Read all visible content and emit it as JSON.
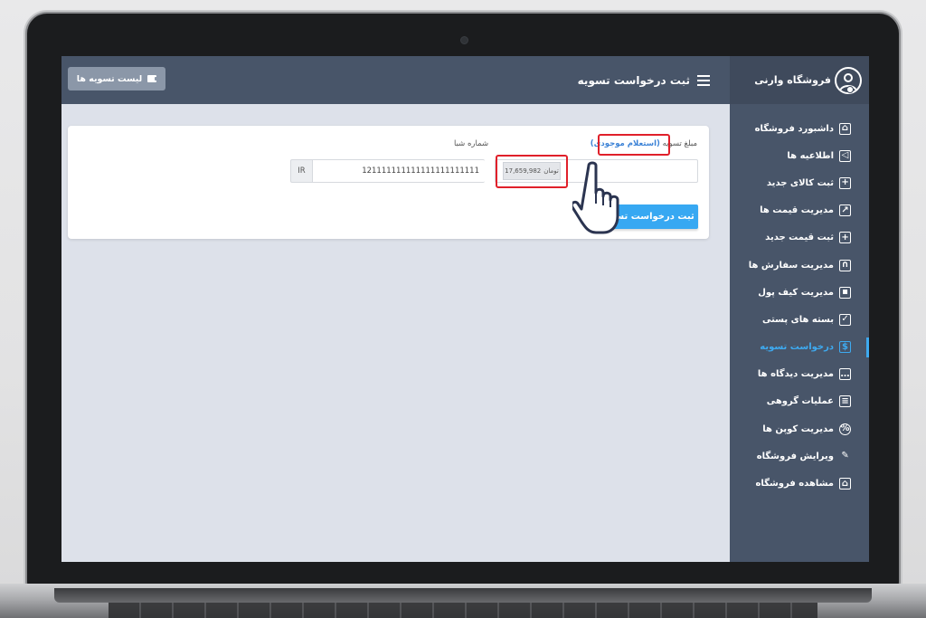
{
  "sidebar": {
    "store_name": "فروشگاه وارنی",
    "items": [
      {
        "label": "داشبورد فروشگاه",
        "icon": "store-icon"
      },
      {
        "label": "اطلاعیه ها",
        "icon": "megaphone-icon"
      },
      {
        "label": "ثبت کالای جدید",
        "icon": "add-box-icon"
      },
      {
        "label": "مدیریت قیمت ها",
        "icon": "chart-line-icon"
      },
      {
        "label": "ثبت قیمت جدید",
        "icon": "cart-add-icon"
      },
      {
        "label": "مدیریت سفارش ها",
        "icon": "shopping-bag-icon"
      },
      {
        "label": "مدیریت کیف پول",
        "icon": "wallet-icon"
      },
      {
        "label": "بسته های پستی",
        "icon": "package-icon"
      },
      {
        "label": "درخواست تسویه",
        "icon": "settlement-icon",
        "active": true
      },
      {
        "label": "مدیریت دیدگاه ها",
        "icon": "comments-icon"
      },
      {
        "label": "عملیات گروهی",
        "icon": "bulk-edit-icon"
      },
      {
        "label": "مدیریت کوپن ها",
        "icon": "coupon-icon"
      },
      {
        "label": "ویرایش فروشگاه",
        "icon": "pencil-icon"
      },
      {
        "label": "مشاهده فروشگاه",
        "icon": "storefront-icon"
      }
    ]
  },
  "topbar": {
    "title": "ثبت درخواست تسویه",
    "list_button": "لیست تسویه ها"
  },
  "form": {
    "amount_label": "مبلغ تسویه",
    "inquiry_link": "(استعلام موجودی)",
    "amount_value": "17,659,982",
    "currency": "تومان",
    "sheba_label": "شماره شبا",
    "sheba_value": "121111111111111111111111",
    "sheba_prefix": "IR",
    "submit_label": "ثبت درخواست تسویه"
  },
  "colors": {
    "sidebar_bg": "#485569",
    "accent": "#37a8f2",
    "highlight": "#e0202a"
  }
}
